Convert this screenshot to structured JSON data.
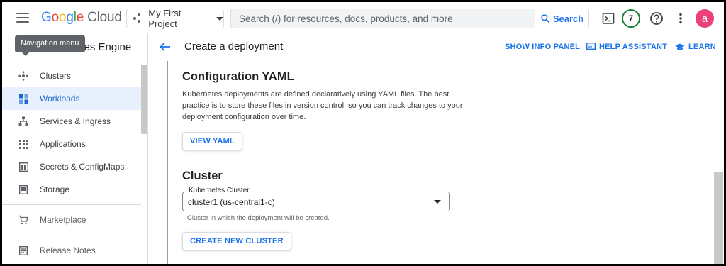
{
  "topbar": {
    "logo": {
      "letters": [
        "G",
        "o",
        "o",
        "g",
        "l",
        "e"
      ],
      "product": "Cloud"
    },
    "project_name": "My First Project",
    "search_placeholder": "Search (/) for resources, docs, products, and more",
    "search_button": "Search",
    "notifications_count": "7",
    "avatar_letter": "a"
  },
  "sidebar": {
    "title": "etes Engine",
    "tooltip": "Navigation menu",
    "items": [
      {
        "label": "Clusters",
        "icon": "clusters-icon",
        "active": false
      },
      {
        "label": "Workloads",
        "icon": "workloads-icon",
        "active": true
      },
      {
        "label": "Services & Ingress",
        "icon": "services-icon",
        "active": false
      },
      {
        "label": "Applications",
        "icon": "applications-icon",
        "active": false
      },
      {
        "label": "Secrets & ConfigMaps",
        "icon": "secrets-icon",
        "active": false
      },
      {
        "label": "Storage",
        "icon": "storage-icon",
        "active": false
      }
    ],
    "extra_items": [
      {
        "label": "Marketplace",
        "icon": "cart-icon"
      },
      {
        "label": "Release Notes",
        "icon": "notes-icon"
      }
    ]
  },
  "header": {
    "title": "Create a deployment",
    "show_info_panel": "SHOW INFO PANEL",
    "help_assistant": "HELP ASSISTANT",
    "learn": "LEARN"
  },
  "config": {
    "heading": "Configuration YAML",
    "description": "Kubernetes deployments are defined declaratively using YAML files. The best practice is to store these files in version control, so you can track changes to your deployment configuration over time.",
    "view_yaml": "VIEW YAML"
  },
  "cluster": {
    "heading": "Cluster",
    "field_label": "Kubernetes Cluster",
    "field_value": "cluster1 (us-central1-c)",
    "helper": "Cluster in which the deployment will be created.",
    "create_button": "CREATE NEW CLUSTER"
  },
  "colors": {
    "accent": "#1a73e8",
    "active_bg": "#e8f0fe",
    "avatar": "#ec407a",
    "badge_ring": "#188038"
  }
}
